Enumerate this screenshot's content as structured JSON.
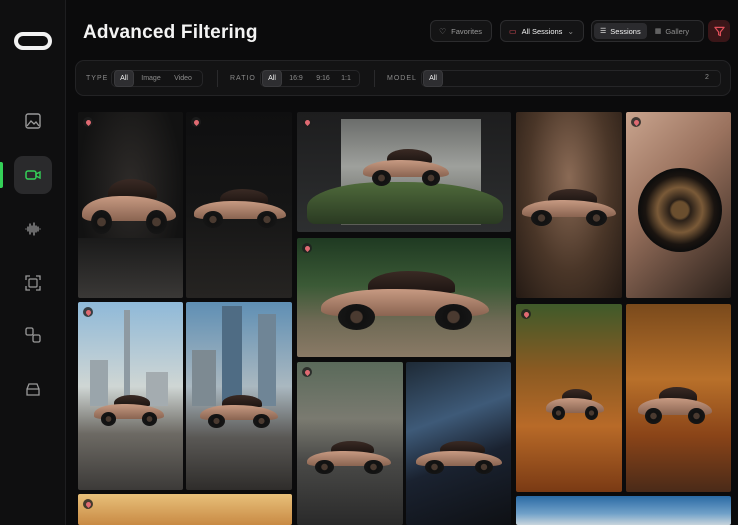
{
  "header": {
    "title": "Advanced Filtering",
    "favorites_label": "Favorites",
    "sessions_dropdown_label": "All Sessions",
    "view_sessions_label": "Sessions",
    "view_gallery_label": "Gallery"
  },
  "filters": {
    "type": {
      "label": "TYPE",
      "options": [
        "All",
        "Image",
        "Video"
      ],
      "selected": "All"
    },
    "ratio": {
      "label": "RATIO",
      "options": [
        "All",
        "16:9",
        "9:16",
        "1:1"
      ],
      "selected": "All"
    },
    "model": {
      "label": "MODEL",
      "options": [
        "All"
      ],
      "selected": "All",
      "count": "2"
    }
  },
  "sidebar": {
    "items": [
      {
        "icon": "image-icon"
      },
      {
        "icon": "video-icon",
        "active": true
      },
      {
        "icon": "audio-waveform-icon"
      },
      {
        "icon": "image-expand-icon"
      },
      {
        "icon": "shapes-icon"
      },
      {
        "icon": "archive-icon"
      }
    ]
  },
  "gallery": {
    "tiles": [
      {
        "scene": "dark-studio",
        "favorited": true
      },
      {
        "scene": "dark-studio-side",
        "favorited": true
      },
      {
        "scene": "rock-landscape",
        "favorited": true
      },
      {
        "scene": "warm-studio",
        "favorited": false
      },
      {
        "scene": "wheel-closeup",
        "favorited": true
      },
      {
        "scene": "forest-road",
        "favorited": true
      },
      {
        "scene": "city-skyline-dubai",
        "favorited": true
      },
      {
        "scene": "city-skyline",
        "favorited": false
      },
      {
        "scene": "motion-road",
        "favorited": true
      },
      {
        "scene": "motion-road-2",
        "favorited": false
      },
      {
        "scene": "autumn-forest",
        "favorited": true
      },
      {
        "scene": "autumn-forest-2",
        "favorited": false
      },
      {
        "scene": "desert",
        "favorited": true
      },
      {
        "scene": "sky",
        "favorited": false
      }
    ]
  },
  "colors": {
    "accent_green": "#34d058",
    "filter_button_red": "#e0505a",
    "background": "#0b0b0c"
  }
}
